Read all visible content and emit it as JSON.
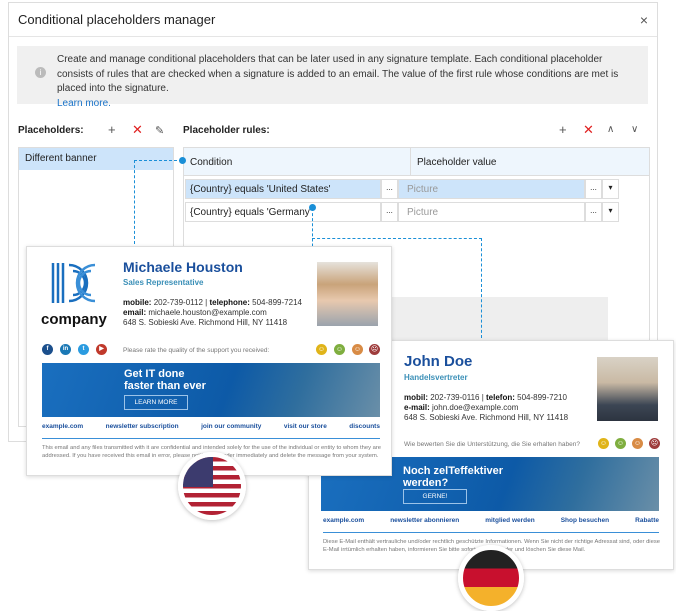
{
  "dialog": {
    "title": "Conditional placeholders manager",
    "close": "×",
    "info": "Create and manage conditional placeholders that can be later used in any signature template. Each conditional placeholder consists of rules that are checked when a signature is added to an email. The value of the first rule whose conditions are met is placed into the signature.",
    "learn_more": "Learn more.",
    "placeholders_label": "Placeholders:",
    "rules_label": "Placeholder rules:",
    "placeholders": [
      {
        "label": "Different banner",
        "selected": true
      }
    ],
    "columns": [
      "Condition",
      "Placeholder value"
    ],
    "rules": [
      {
        "condition": "{Country} equals 'United States'",
        "value": "Picture",
        "selected": true
      },
      {
        "condition": "{Country} equals 'Germany'",
        "value": "Picture",
        "selected": false
      }
    ],
    "ellipsis": "..."
  },
  "us_signature": {
    "logo_text": "company",
    "name": "Michaele Houston",
    "role": "Sales Representative",
    "mobile_label": "mobile:",
    "mobile": "202-739-0112",
    "phone_label": "telephone:",
    "phone": "504-899-7214",
    "email_label": "email:",
    "email": "michaele.houston@example.com",
    "address": "648 S. Sobieski Ave. Richmond Hill, NY 11418",
    "rate": "Please rate the quality of the support you received:",
    "banner_line1": "Get IT done",
    "banner_line2": "faster than ever",
    "banner_button": "LEARN MORE",
    "links": [
      "example.com",
      "newsletter subscription",
      "join our community",
      "visit our store",
      "discounts"
    ],
    "disclaimer": "This email and any files transmitted with it are confidential and intended solely for the use of the individual or entity to whom they are addressed. If you have received this email in error, please notify the sender immediately and delete the message from your system."
  },
  "de_signature": {
    "name": "John Doe",
    "role": "Handelsvertreter",
    "mobile_label": "mobil:",
    "mobile": "202-739-0116",
    "phone_label": "telefon:",
    "phone": "504-899-7210",
    "email_label": "e-mail:",
    "email": "john.doe@example.com",
    "address": "648 S. Sobieski Ave. Richmond Hill, NY 11418",
    "rate": "Wie bewerten Sie die Unterstützung, die Sie erhalten haben?",
    "banner_line1": "Noch zelTeffektiver",
    "banner_line2": "werden?",
    "banner_button": "GERNE!",
    "links": [
      "example.com",
      "newsletter abonnieren",
      "mitglied werden",
      "Shop besuchen",
      "Rabatte"
    ],
    "disclaimer": "Diese E-Mail enthält vertrauliche und/oder rechtlich geschützte Informationen. Wenn Sie nicht der richtige Adressat sind, oder diese E-Mail irrtümlich erhalten haben, informieren Sie bitte sofort den Absender und löschen Sie diese Mail."
  },
  "colors": {
    "accent": "#1a8fd7",
    "selected": "#cde4fa",
    "name": "#1a4f9c",
    "delete": "#e02020"
  }
}
